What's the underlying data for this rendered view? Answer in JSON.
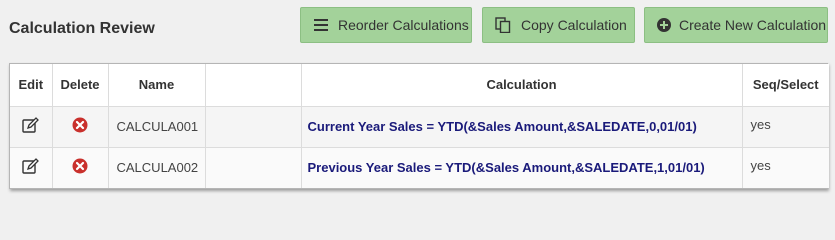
{
  "header": {
    "title": "Calculation Review"
  },
  "toolbar": {
    "reorder_label": "Reorder Calculations",
    "copy_label": "Copy Calculation",
    "create_label": "Create New Calculation"
  },
  "table": {
    "columns": {
      "edit": "Edit",
      "delete": "Delete",
      "name": "Name",
      "blank": "",
      "calculation": "Calculation",
      "seq": "Seq/Select"
    },
    "rows": [
      {
        "name": "CALCULA001",
        "calculation": "Current Year Sales = YTD(&Sales Amount,&SALEDATE,0,01/01)",
        "seq": "yes"
      },
      {
        "name": "CALCULA002",
        "calculation": "Previous Year Sales = YTD(&Sales Amount,&SALEDATE,1,01/01)",
        "seq": "yes"
      }
    ]
  },
  "colors": {
    "button_bg": "#a3d29a",
    "delete_red": "#c9302c",
    "calc_text": "#1a1a7a"
  },
  "icons": {
    "reorder": "list-icon",
    "copy": "copy-icon",
    "create": "plus-circle-icon",
    "edit": "edit-icon",
    "delete": "delete-icon"
  }
}
